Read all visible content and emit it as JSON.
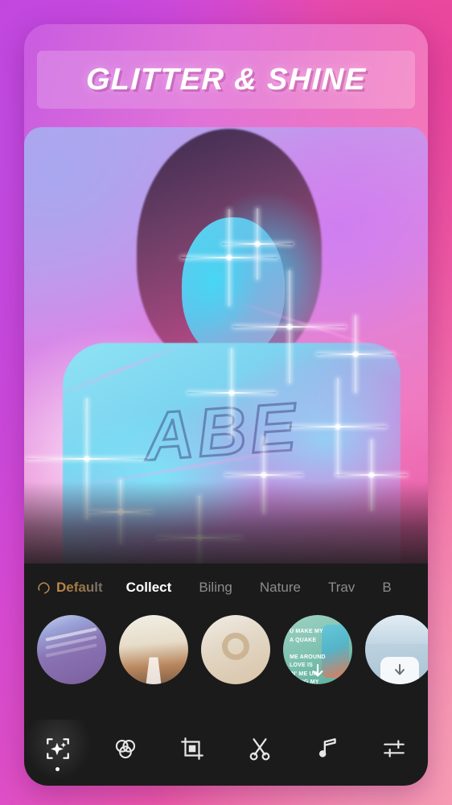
{
  "promo": {
    "banner_title": "GLITTER & SHINE",
    "background_gradient": [
      "#bf41de",
      "#d74ad2",
      "#ef5aa8",
      "#f789ad"
    ]
  },
  "photo": {
    "description": "woman with neon blue and pink lighting and glitter sparkle overlay",
    "shirt_text": "ABE"
  },
  "editor": {
    "tabs": [
      {
        "label": "Default",
        "icon": "diamond-icon",
        "active": false,
        "color": "#b9894f"
      },
      {
        "label": "Collect",
        "active": true,
        "color": "#ffffff"
      },
      {
        "label": "Biling",
        "active": false,
        "color": "#8c8c8c"
      },
      {
        "label": "Nature",
        "active": false,
        "color": "#8c8c8c"
      },
      {
        "label": "Trav",
        "active": false,
        "color": "#8c8c8c"
      },
      {
        "label": "B",
        "active": false,
        "color": "#8c8c8c"
      }
    ],
    "thumbnails": [
      {
        "name": "thumbnail-purple-abstract",
        "class": "th1",
        "download": false
      },
      {
        "name": "thumbnail-road-landscape",
        "class": "th2",
        "download": false
      },
      {
        "name": "thumbnail-beige-vase",
        "class": "th3",
        "download": false
      },
      {
        "name": "thumbnail-green-lyrics",
        "class": "th4",
        "download": true,
        "caption": "U MAKE MY\nA QUAKE\nME AROUND\nLOVE IS\nIN' ME UP\nAKING MY\nDREAM"
      },
      {
        "name": "thumbnail-blue-scene",
        "class": "th5",
        "download": true
      }
    ],
    "toolbar": [
      {
        "label": "Effects",
        "icon": "sparkle-frame-icon",
        "active": true
      },
      {
        "label": "Filters",
        "icon": "three-circles-icon",
        "active": false
      },
      {
        "label": "Crop",
        "icon": "crop-icon",
        "active": false
      },
      {
        "label": "Cut",
        "icon": "scissors-icon",
        "active": false
      },
      {
        "label": "Music",
        "icon": "music-note-icon",
        "active": false
      },
      {
        "label": "Adjust",
        "icon": "sliders-icon",
        "active": false
      }
    ]
  }
}
